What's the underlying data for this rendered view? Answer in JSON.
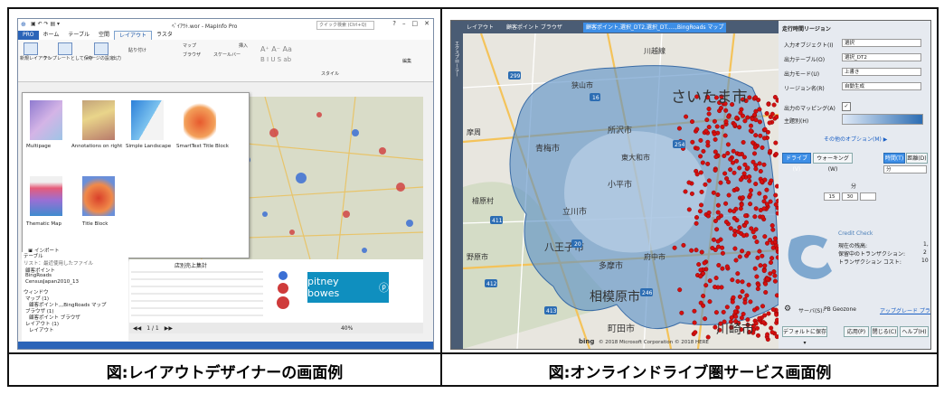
{
  "captions": {
    "left": "図:レイアウトデザイナーの画面例",
    "right": "図:オンラインドライブ圏サービス画面例"
  },
  "left_app": {
    "window_title": "ﾍﾟｲｱｳﾄ.wor - MapInfo Pro",
    "quick_access": "クイック検索 (Ctrl+Q)",
    "tabs": [
      "PRO",
      "ホーム",
      "テーブル",
      "空間",
      "レイアウト",
      "ラスタ"
    ],
    "ribbon_labels": {
      "new_layout": "新規レイアウト",
      "template": "テンプレートとして保存",
      "page_setup": "ページの設定",
      "output": "出力",
      "paste": "貼り付け",
      "map": "マップ",
      "browser": "ブラウザ",
      "scalebar": "スケールバー",
      "insert": "挿入",
      "style": "スタイル",
      "edit": "編集"
    },
    "gallery": [
      {
        "label": "Multipage"
      },
      {
        "label": "Annotations on right"
      },
      {
        "label": "Simple Landscape"
      },
      {
        "label": "SmartText Title Block"
      },
      {
        "label": "Thematic Map"
      },
      {
        "label": "Title Block"
      }
    ],
    "import_label": "インポート",
    "panel": {
      "tables": "テーブル",
      "recent": "リスト：最近使用したファイル",
      "t1": "顧客ポイント",
      "t2": "BingRoads",
      "t3": "CensusJapan2010_13",
      "windows": "ウィンドウ",
      "map_group": "マップ (1)",
      "map_item": "顧客ポイント,,,BingRoads マップ",
      "browser_group": "ブラウザ (1)",
      "browser_item": "顧客ポイント ブラウザ",
      "layout_group": "レイアウト (1)",
      "layout_item": "レイアウト"
    },
    "table_title": "店別売上集計",
    "logo_text": "pitney bowes",
    "page_indicator": "1 / 1",
    "zoom": "40%"
  },
  "right_app": {
    "tabs": [
      "レイアウト",
      "顧客ポイント ブラウザ",
      "顧客ポイント,選択_DT2,選択_DT.....,BingRoads マップ"
    ],
    "side_tab": "エクスプローラー",
    "map_labels": [
      "さいたま市",
      "所沢市",
      "青梅市",
      "檜原村",
      "小平市",
      "立川市",
      "八王子市",
      "多摩市",
      "相模原市",
      "町田市",
      "川崎市",
      "野原市",
      "川越線",
      "狭山市",
      "摩周",
      "府中市",
      "東大和市"
    ],
    "map_road_numbers": [
      "299",
      "16",
      "254",
      "411",
      "412",
      "413",
      "20",
      "246"
    ],
    "copyright": "© 2018 Microsoft Corporation © 2018 HERE",
    "bing": "bing",
    "panel": {
      "title": "走行時間リージョン",
      "input_object": "入力オブジェクト(I)",
      "input_object_value": "選択",
      "output_table": "出力テーブル(O)",
      "output_table_value": "選択_DT2",
      "output_mode": "出力モード(U)",
      "output_mode_value": "上書き",
      "region_name": "リージョン名(R)",
      "region_name_value": "自動生成",
      "output_mapping": "出力のマッピング(A)",
      "theme": "主題別(H)",
      "more_options": "その他のオプション(M) ▶",
      "drive": "ドライブ(V)",
      "walk": "ウォーキング(W)",
      "time": "時間(T)",
      "distance": "距離(D)",
      "unit": "分",
      "unit_label": "分",
      "value1": "15",
      "value2": "30",
      "credit_check": "Credit Check",
      "credit_lines": [
        "現在の残高:",
        "保留中のトランザクション:",
        "トランザクション コスト:"
      ],
      "credit_values": [
        "1,",
        "2",
        "10"
      ],
      "server": "サーバ(S):",
      "server_value": "PB Geozone",
      "upgrade": "アップグレード プラン",
      "save_default": "デフォルトに保存 ▾",
      "apply": "応用(P)",
      "close": "閉じる(C)",
      "help": "ヘルプ(H)"
    }
  }
}
